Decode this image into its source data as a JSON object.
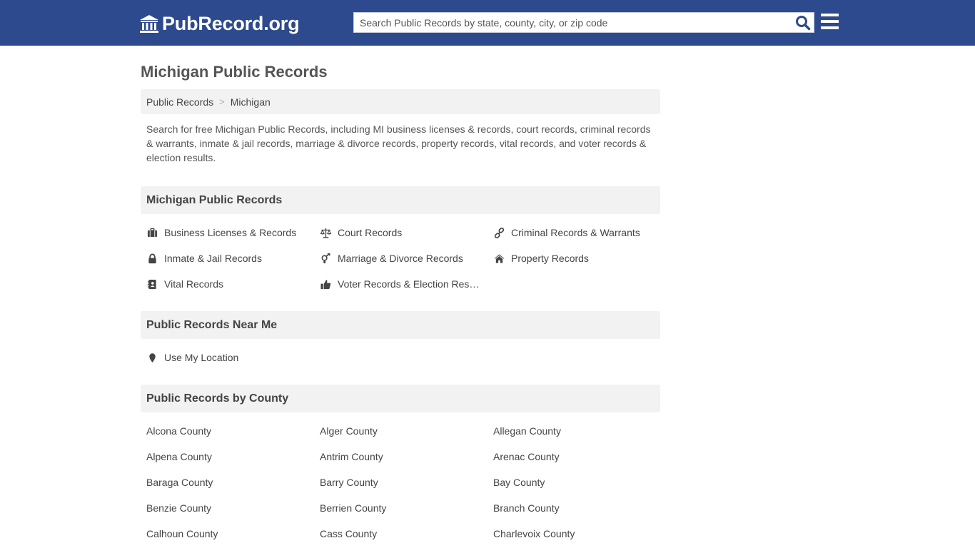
{
  "header": {
    "logo_text": "PubRecord.org",
    "search_placeholder": "Search Public Records by state, county, city, or zip code",
    "brand_color": "#2e4a8e"
  },
  "page": {
    "title": "Michigan Public Records",
    "breadcrumb": [
      "Public Records",
      "Michigan"
    ],
    "intro": "Search for free Michigan Public Records, including MI business licenses & records, court records, criminal records & warrants, inmate & jail records, marriage & divorce records, property records, vital records, and voter records & election results."
  },
  "record_types": {
    "heading": "Michigan Public Records",
    "items": [
      {
        "label": "Business Licenses & Records",
        "icon": "briefcase-icon"
      },
      {
        "label": "Court Records",
        "icon": "scale-icon"
      },
      {
        "label": "Criminal Records & Warrants",
        "icon": "link-icon"
      },
      {
        "label": "Inmate & Jail Records",
        "icon": "lock-icon"
      },
      {
        "label": "Marriage & Divorce Records",
        "icon": "gender-icon"
      },
      {
        "label": "Property Records",
        "icon": "home-icon"
      },
      {
        "label": "Vital Records",
        "icon": "address-book-icon"
      },
      {
        "label": "Voter Records & Election Results",
        "icon": "thumbs-up-icon"
      }
    ]
  },
  "near_me": {
    "heading": "Public Records Near Me",
    "location_label": "Use My Location"
  },
  "counties": {
    "heading": "Public Records by County",
    "items": [
      "Alcona County",
      "Alger County",
      "Allegan County",
      "Alpena County",
      "Antrim County",
      "Arenac County",
      "Baraga County",
      "Barry County",
      "Bay County",
      "Benzie County",
      "Berrien County",
      "Branch County",
      "Calhoun County",
      "Cass County",
      "Charlevoix County"
    ]
  }
}
